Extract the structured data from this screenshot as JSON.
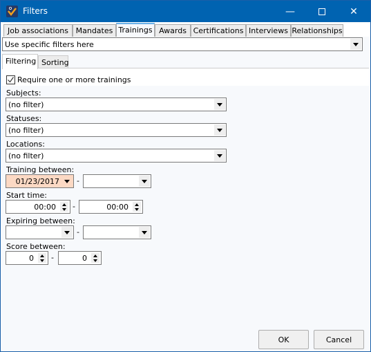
{
  "window": {
    "title": "Filters",
    "minimize_icon": "minimize-icon",
    "maximize_icon": "maximize-icon",
    "close_icon": "close-icon"
  },
  "tabs": [
    {
      "label": "Job associations",
      "active": false
    },
    {
      "label": "Mandates",
      "active": false
    },
    {
      "label": "Trainings",
      "active": true
    },
    {
      "label": "Awards",
      "active": false
    },
    {
      "label": "Certifications",
      "active": false
    },
    {
      "label": "Interviews",
      "active": false
    },
    {
      "label": "Relationships",
      "active": false
    }
  ],
  "filter_mode": {
    "value": "Use specific filters here"
  },
  "subtabs": [
    {
      "label": "Filtering",
      "active": true
    },
    {
      "label": "Sorting",
      "active": false
    }
  ],
  "filtering": {
    "require_checkbox": {
      "label": "Require one or more trainings",
      "checked": true
    },
    "subjects": {
      "label": "Subjects:",
      "value": "(no filter)"
    },
    "statuses": {
      "label": "Statuses:",
      "value": "(no filter)"
    },
    "locations": {
      "label": "Locations:",
      "value": "(no filter)"
    },
    "training_between": {
      "label": "Training between:",
      "from": "01/23/2017",
      "to": "",
      "separator": "-"
    },
    "start_time": {
      "label": "Start time:",
      "from": "00:00",
      "to": "00:00",
      "separator": "-"
    },
    "expiring_between": {
      "label": "Expiring between:",
      "from": "",
      "to": "",
      "separator": "-"
    },
    "score_between": {
      "label": "Score between:",
      "from": "0",
      "to": "0",
      "separator": "-"
    }
  },
  "buttons": {
    "ok": "OK",
    "cancel": "Cancel"
  },
  "colors": {
    "titlebar": "#0063b1",
    "date_highlight": "#fcd9c4",
    "active_tab_accent": "#6ab0e8"
  }
}
